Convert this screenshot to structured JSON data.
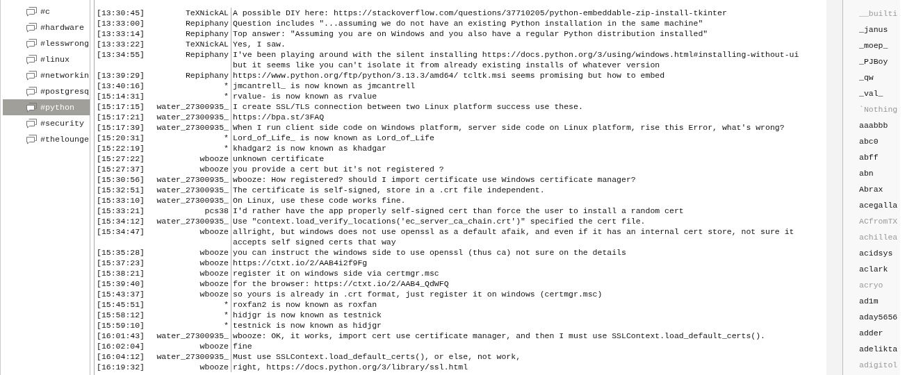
{
  "channels": [
    {
      "label": "#c",
      "selected": false
    },
    {
      "label": "#hardware",
      "selected": false
    },
    {
      "label": "#lesswrong",
      "selected": false
    },
    {
      "label": "#linux",
      "selected": false
    },
    {
      "label": "#networkin",
      "selected": false
    },
    {
      "label": "#postgresq",
      "selected": false
    },
    {
      "label": "#python",
      "selected": true
    },
    {
      "label": "#security",
      "selected": false
    },
    {
      "label": "#thelounge",
      "selected": false
    }
  ],
  "messages": [
    {
      "time": "[13:30:45]",
      "nick": "TeXNickAL",
      "text": "A possible DIY here: https://stackoverflow.com/questions/37710205/python-embeddable-zip-install-tkinter"
    },
    {
      "time": "[13:33:00]",
      "nick": "Repiphany",
      "text": "Question includes \"...assuming we do not have an existing Python installation in the same machine\""
    },
    {
      "time": "[13:33:14]",
      "nick": "Repiphany",
      "text": "Top answer: \"Assuming you are on Windows and you also have a regular Python distribution installed\""
    },
    {
      "time": "[13:33:22]",
      "nick": "TeXNickAL",
      "text": "Yes, I saw."
    },
    {
      "time": "[13:34:55]",
      "nick": "Repiphany",
      "text": "I've been playing around with the silent installing https://docs.python.org/3/using/windows.html#installing-without-ui but it seems like you can't isolate it from already existing installs of whatever version"
    },
    {
      "time": "[13:39:29]",
      "nick": "Repiphany",
      "text": "https://www.python.org/ftp/python/3.13.3/amd64/ tcltk.msi seems promising but how to embed"
    },
    {
      "time": "[13:40:16]",
      "nick": "*",
      "text": "jmcantrell_ is now known as jmcantrell"
    },
    {
      "time": "[15:14:31]",
      "nick": "*",
      "text": "rvalue- is now known as rvalue"
    },
    {
      "time": "[15:17:15]",
      "nick": "water_27300935_",
      "text": "I create SSL/TLS connection between two Linux platform success use these."
    },
    {
      "time": "[15:17:21]",
      "nick": "water_27300935_",
      "text": "https://bpa.st/3FAQ"
    },
    {
      "time": "[15:17:39]",
      "nick": "water_27300935_",
      "text": "When I run client side code on Windows platform, server side code on Linux platform, rise this Error, what's wrong?"
    },
    {
      "time": "[15:20:31]",
      "nick": "*",
      "text": "Lord_of_Life_ is now known as Lord_of_Life"
    },
    {
      "time": "[15:22:19]",
      "nick": "*",
      "text": "khadgar2 is now known as khadgar"
    },
    {
      "time": "[15:27:22]",
      "nick": "wbooze",
      "text": "unknown certificate"
    },
    {
      "time": "[15:27:37]",
      "nick": "wbooze",
      "text": "you provide a cert but it's not registered ?"
    },
    {
      "time": "[15:30:56]",
      "nick": "water_27300935_",
      "text": "wbooze: How registered? should I import certificate use Windows certificate manager?"
    },
    {
      "time": "[15:32:51]",
      "nick": "water_27300935_",
      "text": "The certificate is self-signed, store in a .crt file independent."
    },
    {
      "time": "[15:33:10]",
      "nick": "water_27300935_",
      "text": "On Linux, use these code works fine."
    },
    {
      "time": "[15:33:21]",
      "nick": "pcs38",
      "text": "I'd rather have the app properly self-signed cert than force the user to install a random cert"
    },
    {
      "time": "[15:34:12]",
      "nick": "water_27300935_",
      "text": "Use \"context.load_verify_locations('ec_server_ca_chain.crt')\" specified the cert file."
    },
    {
      "time": "[15:34:47]",
      "nick": "wbooze",
      "text": "allright, but windows does not use openssl as a default afaik, and even if it has an internal cert store, not sure it accepts self signed certs that way"
    },
    {
      "time": "[15:35:28]",
      "nick": "wbooze",
      "text": "you can instruct the windows side to use openssl (thus ca) not sure on the details"
    },
    {
      "time": "[15:37:23]",
      "nick": "wbooze",
      "text": "https://ctxt.io/2/AAB4i2f9Fg"
    },
    {
      "time": "[15:38:21]",
      "nick": "wbooze",
      "text": "register it on windows side via certmgr.msc"
    },
    {
      "time": "[15:39:40]",
      "nick": "wbooze",
      "text": "for the browser: https://ctxt.io/2/AAB4_QdWFQ"
    },
    {
      "time": "[15:43:37]",
      "nick": "wbooze",
      "text": "so yours is already in .crt format, just register it on windows (certmgr.msc)"
    },
    {
      "time": "[15:45:51]",
      "nick": "*",
      "text": "roxfan2 is now known as roxfan"
    },
    {
      "time": "[15:58:12]",
      "nick": "*",
      "text": "hidjgr is now known as testnick"
    },
    {
      "time": "[15:59:10]",
      "nick": "*",
      "text": "testnick is now known as hidjgr"
    },
    {
      "time": "[16:01:43]",
      "nick": "water_27300935_",
      "text": "wbooze: OK, it works, import cert use certificate manager, and then I must use SSLContext.load_default_certs()."
    },
    {
      "time": "[16:02:04]",
      "nick": "wbooze",
      "text": "fine"
    },
    {
      "time": "[16:04:12]",
      "nick": "water_27300935_",
      "text": "Must use SSLContext.load_default_certs(), or else, not work,"
    },
    {
      "time": "[16:19:32]",
      "nick": "wbooze",
      "text": "right, https://docs.python.org/3/library/ssl.html"
    }
  ],
  "users": [
    {
      "name": "__builti",
      "away": true
    },
    {
      "name": "_janus",
      "away": false
    },
    {
      "name": "_moep_",
      "away": false
    },
    {
      "name": "_PJBoy",
      "away": false
    },
    {
      "name": "_qw",
      "away": false
    },
    {
      "name": "_val_",
      "away": false
    },
    {
      "name": "`Nothing",
      "away": true
    },
    {
      "name": "aaabbb",
      "away": false
    },
    {
      "name": "abc0",
      "away": false
    },
    {
      "name": "abff",
      "away": false
    },
    {
      "name": "abn",
      "away": false
    },
    {
      "name": "Abrax",
      "away": false
    },
    {
      "name": "acegalla",
      "away": false
    },
    {
      "name": "ACfromTX",
      "away": true
    },
    {
      "name": "achillea",
      "away": true
    },
    {
      "name": "acidsys",
      "away": false
    },
    {
      "name": "aclark",
      "away": false
    },
    {
      "name": "acryo",
      "away": true
    },
    {
      "name": "ad1m",
      "away": false
    },
    {
      "name": "aday5656",
      "away": false
    },
    {
      "name": "adder",
      "away": false
    },
    {
      "name": "adelikta",
      "away": false
    },
    {
      "name": "adigitol",
      "away": true
    }
  ]
}
